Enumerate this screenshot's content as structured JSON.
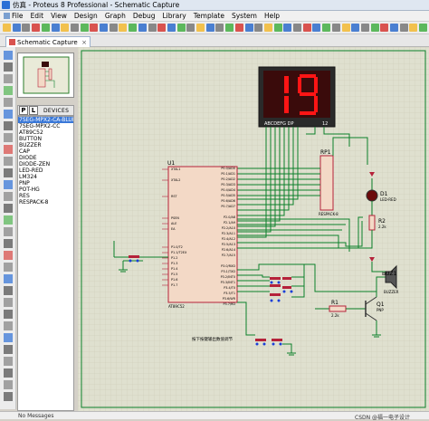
{
  "window": {
    "title": "仿真 - Proteus 8 Professional - Schematic Capture"
  },
  "menu": [
    "File",
    "Edit",
    "View",
    "Design",
    "Graph",
    "Debug",
    "Library",
    "Template",
    "System",
    "Help"
  ],
  "tab": {
    "label": "Schematic Capture",
    "close": "×"
  },
  "devices": {
    "header": "DEVICES",
    "pick_label": "P",
    "lib_label": "L",
    "items": [
      "7SEG-MPX2-CA-BLUE",
      "7SEG-MPX2-CC",
      "AT89C52",
      "BUTTON",
      "BUZZER",
      "CAP",
      "DIODE",
      "DIODE-ZEN",
      "LED-RED",
      "LM324",
      "PNP",
      "POT-HG",
      "RES",
      "RESPACK-8"
    ],
    "selected_index": 0
  },
  "schematic": {
    "display": {
      "value": "19",
      "label": "ABCDEFG  DP",
      "pins": "12"
    },
    "u1": {
      "ref": "U1",
      "part": "AT89C52",
      "left_pins": [
        "XTAL1",
        "XTAL2",
        "RST",
        "PSEN",
        "ALE",
        "EA",
        "P1.0/T2",
        "P1.1/T2EX",
        "P1.2",
        "P1.3",
        "P1.4",
        "P1.5",
        "P1.6",
        "P1.7"
      ],
      "right_pins": [
        "P0.0/AD0",
        "P0.1/AD1",
        "P0.2/AD2",
        "P0.3/AD3",
        "P0.4/AD4",
        "P0.5/AD5",
        "P0.6/AD6",
        "P0.7/AD7",
        "P2.0/A8",
        "P2.1/A9",
        "P2.2/A10",
        "P2.3/A11",
        "P2.4/A12",
        "P2.5/A13",
        "P2.6/A14",
        "P2.7/A15",
        "P3.0/RXD",
        "P3.1/TXD",
        "P3.2/INT0",
        "P3.3/INT1",
        "P3.4/T0",
        "P3.5/T1",
        "P3.6/WR",
        "P3.7/RD"
      ]
    },
    "rp1": {
      "ref": "RP1",
      "part": "RESPACK-8"
    },
    "d1": {
      "ref": "D1",
      "part": "LED-RED"
    },
    "r2": {
      "ref": "R2",
      "value": "2.2k"
    },
    "buz1": {
      "ref": "BUZ1",
      "part": "BUZZER"
    },
    "r1": {
      "ref": "R1",
      "value": "2.2k"
    },
    "q1": {
      "ref": "Q1",
      "part": "PNP"
    },
    "note": "按下按键输出数值调节"
  },
  "status": {
    "messages": "No Messages",
    "watermark": "CSDN @福一电子设计"
  },
  "colors": {
    "wire": "#0b7f2a",
    "component": "#b5223a",
    "body_fill": "#f3d9c6",
    "grid_bg": "#dfe0cf",
    "display_bg": "#3a0b0b",
    "segment_on": "#ff1515",
    "selection": "#3a78d8"
  },
  "icons": {
    "app": "proteus-app-icon",
    "tab": "schematic-tab-icon"
  }
}
